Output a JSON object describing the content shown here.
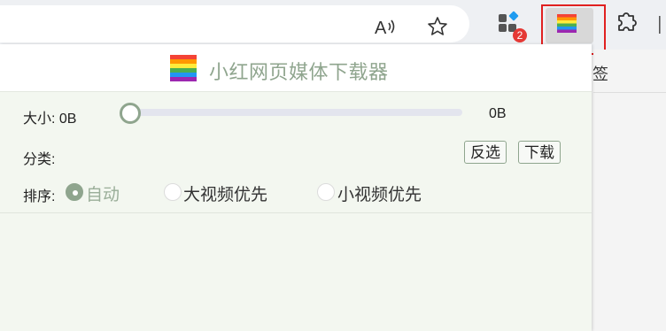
{
  "browser": {
    "read_aloud_icon": "read-aloud-icon",
    "favorite_icon": "star-icon",
    "extensions_badge": "2",
    "puzzle_icon": "extensions-puzzle-icon",
    "right_strip_text": "签"
  },
  "popup": {
    "title": "小红网页媒体下载器",
    "size": {
      "label": "大小: 0B",
      "value": "0B",
      "slider_level": 0
    },
    "category": {
      "label": "分类:",
      "invert_button": "反选",
      "download_button": "下载"
    },
    "sort": {
      "label": "排序:",
      "options": [
        {
          "label": "自动",
          "checked": true
        },
        {
          "label": "大视频优先",
          "checked": false
        },
        {
          "label": "小视频优先",
          "checked": false
        }
      ]
    }
  },
  "colors": {
    "accent": "#8fa58e",
    "highlight_box": "#e02020",
    "badge": "#e53935"
  }
}
